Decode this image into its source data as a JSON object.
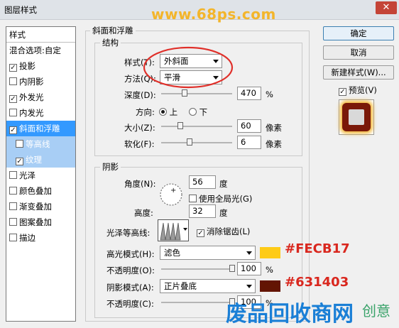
{
  "window": {
    "title": "图层样式",
    "watermark": "www.68ps.com",
    "close_glyph": "✕"
  },
  "left_panel": {
    "header": "样式",
    "items": [
      {
        "label": "混合选项:自定",
        "checkbox": false,
        "checked": false,
        "state": "normal"
      },
      {
        "label": "投影",
        "checkbox": true,
        "checked": true,
        "state": "normal"
      },
      {
        "label": "内阴影",
        "checkbox": true,
        "checked": false,
        "state": "normal"
      },
      {
        "label": "外发光",
        "checkbox": true,
        "checked": true,
        "state": "normal"
      },
      {
        "label": "内发光",
        "checkbox": true,
        "checked": false,
        "state": "normal"
      },
      {
        "label": "斜面和浮雕",
        "checkbox": true,
        "checked": true,
        "state": "selected"
      },
      {
        "label": "等高线",
        "checkbox": true,
        "checked": false,
        "state": "sub"
      },
      {
        "label": "纹理",
        "checkbox": true,
        "checked": true,
        "state": "sub"
      },
      {
        "label": "光泽",
        "checkbox": true,
        "checked": false,
        "state": "normal"
      },
      {
        "label": "颜色叠加",
        "checkbox": true,
        "checked": false,
        "state": "normal"
      },
      {
        "label": "渐变叠加",
        "checkbox": true,
        "checked": false,
        "state": "normal"
      },
      {
        "label": "图案叠加",
        "checkbox": true,
        "checked": false,
        "state": "normal"
      },
      {
        "label": "描边",
        "checkbox": true,
        "checked": false,
        "state": "normal"
      }
    ]
  },
  "bevel": {
    "title": "斜面和浮雕",
    "structure": {
      "title": "结构",
      "style_label": "样式(T):",
      "style_value": "外斜面",
      "technique_label": "方法(Q):",
      "technique_value": "平滑",
      "depth_label": "深度(D):",
      "depth_value": "470",
      "depth_unit": "%",
      "depth_level": 0.3,
      "direction_label": "方向:",
      "direction_up": "上",
      "direction_down": "下",
      "direction_selected": "上",
      "size_label": "大小(Z):",
      "size_value": "60",
      "size_unit": "像素",
      "size_level": 0.24,
      "soften_label": "软化(F):",
      "soften_value": "6",
      "soften_unit": "像素",
      "soften_level": 0.37
    },
    "shading": {
      "title": "阴影",
      "angle_label": "角度(N):",
      "angle_value": "56",
      "angle_unit": "度",
      "global_light_label": "使用全局光(G)",
      "global_light_checked": false,
      "altitude_label": "高度:",
      "altitude_value": "32",
      "altitude_unit": "度",
      "gloss_contour_label": "光泽等高线:",
      "antialias_label": "消除锯齿(L)",
      "antialias_checked": true,
      "highlight_mode_label": "高光模式(H):",
      "highlight_mode_value": "滤色",
      "highlight_opacity_label": "不透明度(O):",
      "highlight_opacity_value": "100",
      "highlight_opacity_unit": "%",
      "highlight_opacity_level": 1.0,
      "shadow_mode_label": "阴影模式(A):",
      "shadow_mode_value": "正片叠底",
      "shadow_opacity_label": "不透明度(C):",
      "shadow_opacity_value": "100",
      "shadow_opacity_unit": "%",
      "shadow_opacity_level": 1.0
    }
  },
  "buttons": {
    "ok": "确定",
    "cancel": "取消",
    "new_style": "新建样式(W)...",
    "preview_label": "预览(V)",
    "preview_checked": true
  },
  "annotations": {
    "highlight_hex": "#FECB17",
    "shadow_hex": "#631403",
    "bottom_watermark": "废品回收商网",
    "bottom_watermark_tail": "创意"
  },
  "colors": {
    "highlight_swatch": "#fecb17",
    "shadow_swatch": "#631403",
    "annotation_text": "#d9271e",
    "selected_item": "#3399ff",
    "sub_item": "#a8cef5",
    "circle_highlight": "#e0302a",
    "watermark": "#f3b52b",
    "bottom_watermark": "#1a7fd6"
  },
  "icons": [
    "close-icon",
    "angle-dial-icon",
    "contour-preview-icon",
    "dropdown-arrow-icon",
    "style-preview-thumbnail"
  ]
}
